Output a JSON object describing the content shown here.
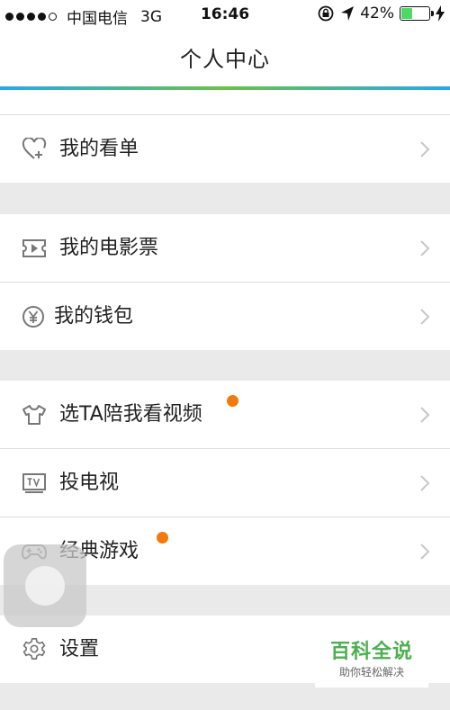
{
  "status_bar": {
    "carrier": "中国电信",
    "network": "3G",
    "time": "16:46",
    "battery": "42%",
    "battery_level": 0.42,
    "battery_color": "#4cd964"
  },
  "header": {
    "title": "个人中心",
    "accent_colors": [
      "#27a8e8",
      "#6cc04a"
    ]
  },
  "menu": {
    "watchlist": {
      "label": "我的看单",
      "icon": "heart-plus-icon"
    },
    "tickets": {
      "label": "我的电影票",
      "icon": "ticket-play-icon"
    },
    "wallet": {
      "label": "我的钱包",
      "icon": "yuan-coin-icon"
    },
    "companion_video": {
      "label": "选TA陪我看视频",
      "icon": "tshirt-icon",
      "has_badge": true
    },
    "cast_tv": {
      "label": "投电视",
      "icon": "tv-icon"
    },
    "classic_games": {
      "label": "经典游戏",
      "icon": "gamepad-icon",
      "has_badge": true
    },
    "settings": {
      "label": "设置",
      "icon": "gear-icon"
    }
  },
  "badge_color": "#f27a0c",
  "watermark": {
    "title": "百科全说",
    "subtitle": "助你轻松解决"
  }
}
